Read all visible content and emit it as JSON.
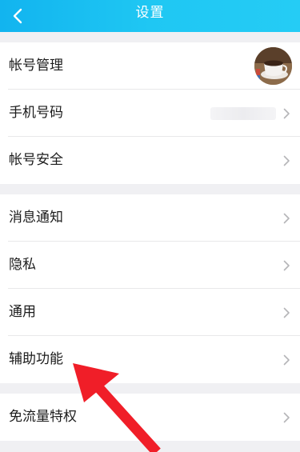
{
  "header": {
    "title": "设置",
    "background_color": "#1ec4f2",
    "back_icon": "chevron-left-icon"
  },
  "groups": [
    {
      "items": [
        {
          "label": "帐号管理",
          "trailing": "avatar"
        },
        {
          "label": "手机号码",
          "trailing": "masked-value"
        },
        {
          "label": "帐号安全",
          "trailing": "chevron"
        }
      ]
    },
    {
      "items": [
        {
          "label": "消息通知",
          "trailing": "chevron"
        },
        {
          "label": "隐私",
          "trailing": "chevron"
        },
        {
          "label": "通用",
          "trailing": "chevron"
        },
        {
          "label": "辅助功能",
          "trailing": "chevron"
        }
      ]
    },
    {
      "items": [
        {
          "label": "免流量特权",
          "trailing": "chevron"
        }
      ]
    }
  ],
  "annotation": {
    "type": "red-arrow",
    "points_to": "辅助功能",
    "color": "#f01e28"
  },
  "colors": {
    "page_background": "#f0f0f3",
    "row_background": "#ffffff",
    "separator": "#e8e8ea",
    "chevron": "#b5b5b8"
  }
}
